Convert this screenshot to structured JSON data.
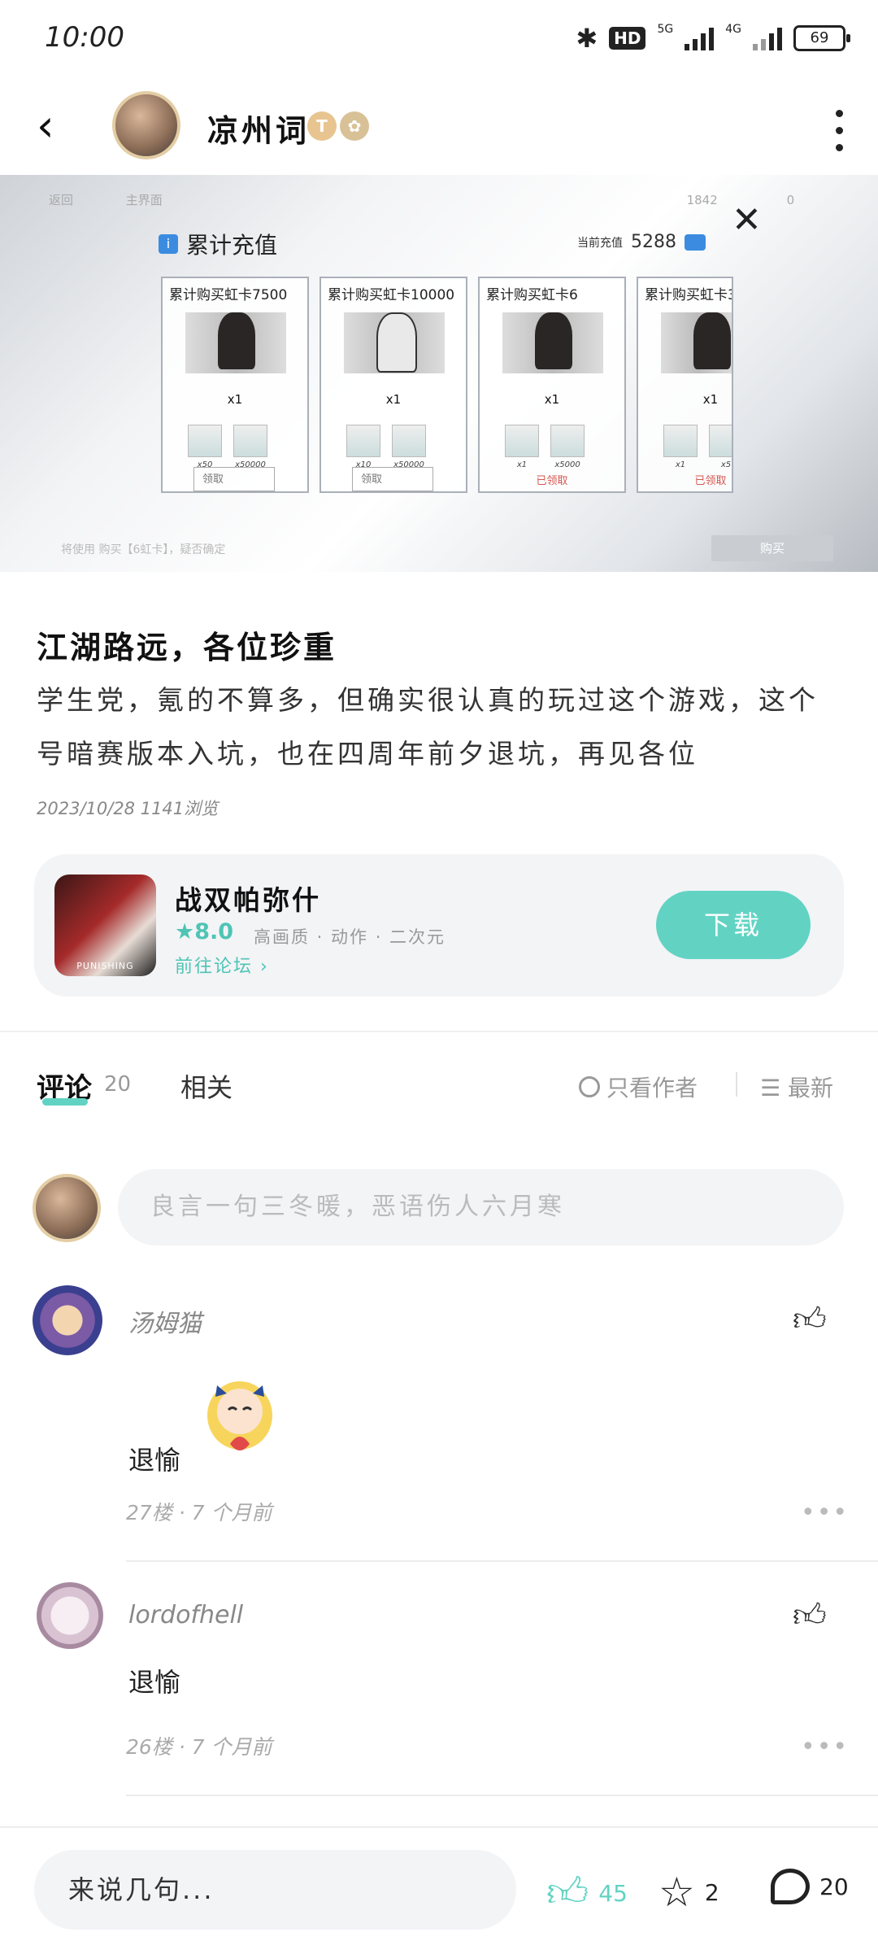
{
  "status": {
    "time": "10:00",
    "hd": "HD",
    "net1": "5G",
    "net2": "4G",
    "battery": "69"
  },
  "header": {
    "username": "凉州词",
    "badge1": "T"
  },
  "hero": {
    "top_back": "返回",
    "top_home": "主界面",
    "top_num1": "1842",
    "top_num2": "0",
    "title": "累计充值",
    "current_label": "当前充值",
    "current_value": "5288",
    "cards": [
      {
        "title": "累计购买虹卡7500",
        "qty": "x1",
        "item1": "x50",
        "item2": "x50000",
        "button": "领取"
      },
      {
        "title": "累计购买虹卡10000",
        "qty": "x1",
        "item1": "x10",
        "item2": "x50000",
        "button": "领取"
      },
      {
        "title": "累计购买虹卡6",
        "qty": "x1",
        "item1": "x1",
        "item2": "x5000",
        "status": "已领取"
      },
      {
        "title": "累计购买虹卡3",
        "qty": "x1",
        "item1": "x1",
        "item2": "x5",
        "status": "已领取"
      }
    ],
    "footer": "将使用 购买【6虹卡】，疑否确定",
    "buy": "购买"
  },
  "post": {
    "title": "江湖路远，各位珍重",
    "body": "学生党，氪的不算多，但确实很认真的玩过这个游戏，这个号暗赛版本入坑，也在四周年前夕退坑，再见各位",
    "meta": "2023/10/28  1141浏览"
  },
  "game": {
    "icon_text": "PUNISHING",
    "name": "战双帕弥什",
    "rating": "8.0",
    "tags": "高画质 · 动作 · 二次元",
    "forum": "前往论坛",
    "download": "下载"
  },
  "tabs": {
    "comments": "评论",
    "comments_count": "20",
    "related": "相关",
    "only_author": "只看作者",
    "sort": "最新"
  },
  "comment_input": {
    "placeholder": "良言一句三冬暖，恶语伤人六月寒"
  },
  "comments": [
    {
      "name": "汤姆猫",
      "text": "退愉",
      "meta": "27楼 · 7 个月前"
    },
    {
      "name": "lordofhell",
      "text": "退愉",
      "meta": "26楼 · 7 个月前"
    }
  ],
  "bottom": {
    "say": "来说几句...",
    "likes": "45",
    "stars": "2",
    "comments": "20"
  },
  "colors": {
    "accent": "#62d3c3",
    "accent_text": "#4fc4b5"
  }
}
